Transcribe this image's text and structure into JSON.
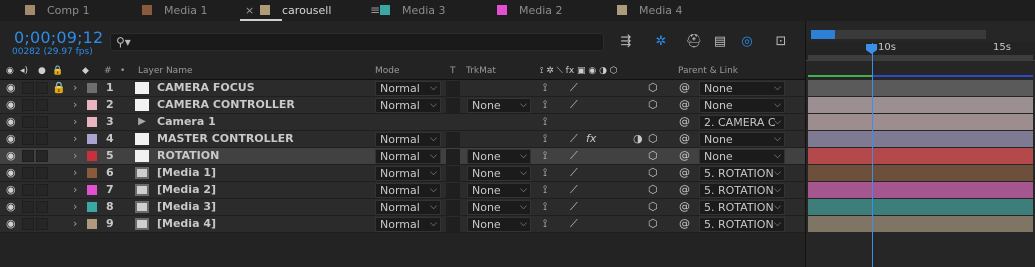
{
  "tabs": [
    {
      "label": "Comp 1",
      "color": "#a28a6a"
    },
    {
      "label": "Media 1",
      "color": "#8a5a3c"
    },
    {
      "label": "carousell",
      "color": "#b09a78",
      "active": true,
      "close": "×",
      "menu": "≡"
    },
    {
      "label": "Media 3",
      "color": "#3aa7a3"
    },
    {
      "label": "Media 2",
      "color": "#e24fd0"
    },
    {
      "label": "Media 4",
      "color": "#ae9b7e"
    }
  ],
  "toolbar": {
    "timecode": "0;00;09;12",
    "frames": "00282 (29.97 fps)",
    "search_placeholder": "",
    "search_icon": "search-icon",
    "icons": [
      "comp-mini-flowchart-icon",
      "draft-3d-icon",
      "shy-layers-icon",
      "frame-blending-icon",
      "motion-blur-icon",
      "graph-editor-icon"
    ]
  },
  "headers": {
    "layer_name": "Layer Name",
    "mode": "Mode",
    "t": "T",
    "trkmat": "TrkMat",
    "parent": "Parent & Link",
    "hash": "#"
  },
  "layers": [
    {
      "num": "1",
      "name": "CAMERA FOCUS",
      "color": "#6e6e6e",
      "src": "solid",
      "mode": "Normal",
      "trkmat": "",
      "parent": "None",
      "locked": true,
      "fx": false
    },
    {
      "num": "2",
      "name": "CAMERA CONTROLLER",
      "color": "#e8b4c2",
      "src": "solid",
      "mode": "Normal",
      "trkmat": "None",
      "parent": "None",
      "locked": false,
      "fx": false
    },
    {
      "num": "3",
      "name": "Camera 1",
      "color": "#e8b4c2",
      "src": "camera",
      "mode": "",
      "trkmat": "",
      "parent": "2. CAMERA C",
      "locked": false,
      "fx": false
    },
    {
      "num": "4",
      "name": "MASTER CONTROLLER",
      "color": "#a9a4cf",
      "src": "solid",
      "mode": "Normal",
      "trkmat": "",
      "parent": "None",
      "locked": false,
      "fx": true
    },
    {
      "num": "5",
      "name": "ROTATION",
      "color": "#c8313b",
      "src": "solid",
      "mode": "Normal",
      "trkmat": "None",
      "parent": "None",
      "locked": false,
      "fx": false,
      "selected": true
    },
    {
      "num": "6",
      "name": "[Media 1]",
      "color": "#8a5a3c",
      "src": "footage",
      "mode": "Normal",
      "trkmat": "None",
      "parent": "5. ROTATION",
      "locked": false,
      "fx": false
    },
    {
      "num": "7",
      "name": "[Media 2]",
      "color": "#e24fd0",
      "src": "footage",
      "mode": "Normal",
      "trkmat": "None",
      "parent": "5. ROTATION",
      "locked": false,
      "fx": false
    },
    {
      "num": "8",
      "name": "[Media 3]",
      "color": "#3aa7a3",
      "src": "footage",
      "mode": "Normal",
      "trkmat": "None",
      "parent": "5. ROTATION",
      "locked": false,
      "fx": false
    },
    {
      "num": "9",
      "name": "[Media 4]",
      "color": "#ae9b7e",
      "src": "footage",
      "mode": "Normal",
      "trkmat": "None",
      "parent": "5. ROTATION",
      "locked": false,
      "fx": false
    }
  ],
  "timeline": {
    "ticks": [
      "10s",
      "15s"
    ],
    "bars": [
      "#5a5a5a",
      "#9c8f91",
      "#9e8d8f",
      "#7d7a92",
      "#b4494c",
      "#6e4f3c",
      "#a5568f",
      "#3d7d7a",
      "#7f7565"
    ]
  }
}
